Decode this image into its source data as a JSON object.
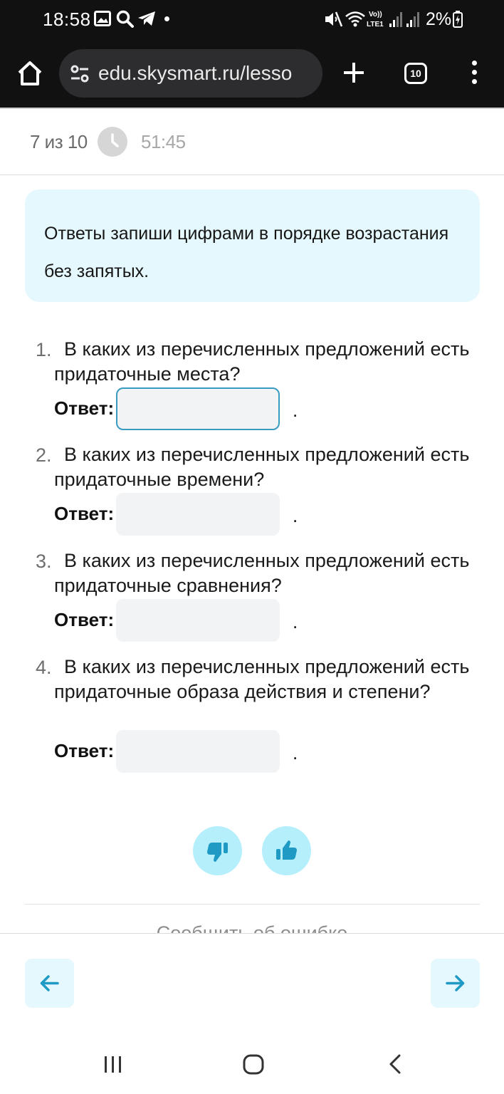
{
  "status_bar": {
    "time": "18:58",
    "battery": "2%"
  },
  "browser": {
    "url": "edu.skysmart.ru/lesso",
    "tab_count": "10"
  },
  "progress": {
    "position": "7 из 10",
    "timer": "51:45"
  },
  "instruction": "Ответы запиши цифрами в порядке возрастания без запятых.",
  "questions": [
    {
      "number": "1.",
      "text": "В каких из перечисленных предложений есть придаточные места?",
      "answer_label": "Ответ:",
      "answer_value": "",
      "suffix": "."
    },
    {
      "number": "2.",
      "text": "В каких из перечисленных предложений есть придаточные времени?",
      "answer_label": "Ответ:",
      "answer_value": "",
      "suffix": "."
    },
    {
      "number": "3.",
      "text": "В каких из перечисленных предложений есть придаточные сравнения?",
      "answer_label": "Ответ:",
      "answer_value": "",
      "suffix": "."
    },
    {
      "number": "4.",
      "text": "В каких из перечисленных предложений есть придаточные образа действия и степени?",
      "answer_label": "Ответ:",
      "answer_value": "",
      "suffix": "."
    }
  ],
  "report_link": "Сообщить об ошибке",
  "colors": {
    "accent": "#1e9ac4",
    "light_cyan": "#e5f8fd",
    "feedback_bg": "#b6effc",
    "input_focus_border": "#3a9bc1"
  },
  "icons": {
    "feedback_dislike": "thumbs-down-icon",
    "feedback_like": "thumbs-up-icon",
    "prev": "arrow-left-icon",
    "next": "arrow-right-icon"
  }
}
